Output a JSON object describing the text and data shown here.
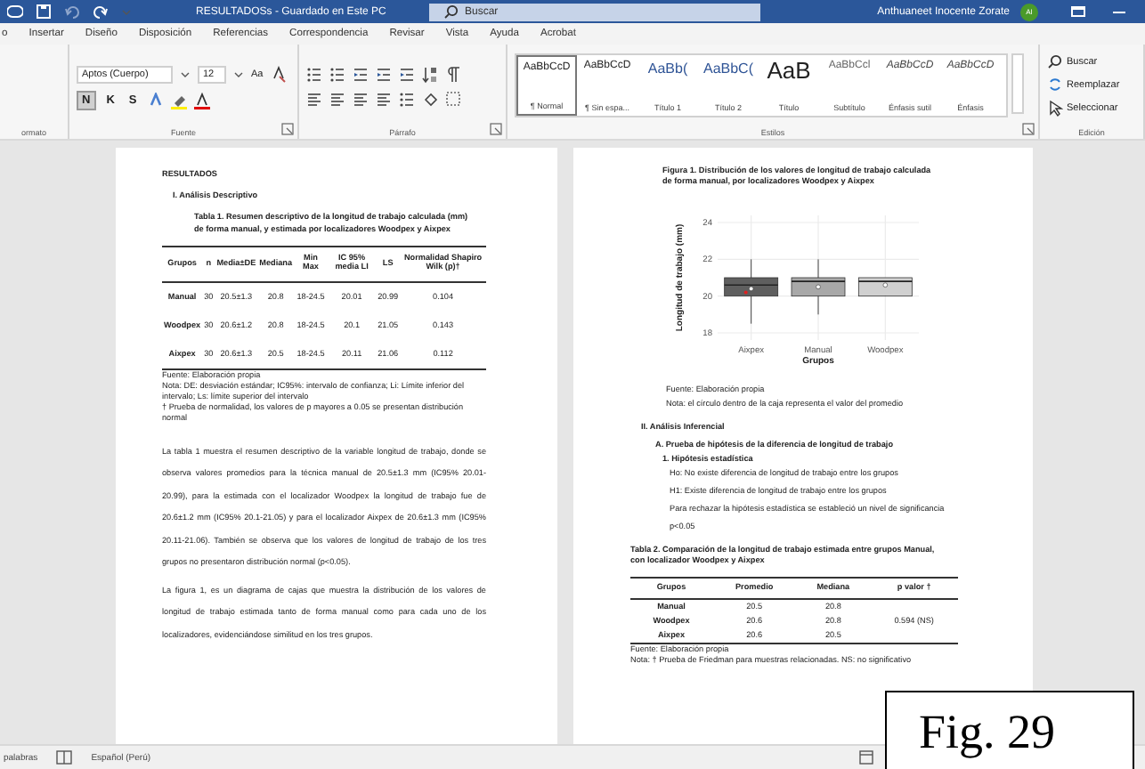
{
  "title_bar": {
    "document_title": "RESULTADOSs - Guardado en Este PC",
    "search_placeholder": "Buscar",
    "user_name": "Anthuaneet Inocente Zorate",
    "avatar_initials": "AI"
  },
  "menu_tabs": [
    {
      "label": "o",
      "selected": false
    },
    {
      "label": "Insertar",
      "selected": false
    },
    {
      "label": "Diseño",
      "selected": false
    },
    {
      "label": "Disposición",
      "selected": false
    },
    {
      "label": "Referencias",
      "selected": false
    },
    {
      "label": "Correspondencia",
      "selected": false
    },
    {
      "label": "Revisar",
      "selected": false
    },
    {
      "label": "Vista",
      "selected": false
    },
    {
      "label": "Ayuda",
      "selected": false
    },
    {
      "label": "Acrobat",
      "selected": false
    }
  ],
  "ribbon": {
    "left_group_label": "ormato",
    "font_name": "Aptos (Cuerpo)",
    "font_size": "12",
    "case_button": "Aa",
    "format_buttons": [
      {
        "label": "N",
        "on": true
      },
      {
        "label": "K",
        "on": false
      },
      {
        "label": "S",
        "on": false
      }
    ],
    "groups": [
      "Fuente",
      "Párrafo",
      "Estilos",
      "Edición"
    ],
    "styles": [
      {
        "preview": "AaBbCcD",
        "label": "¶ Normal",
        "selected": true,
        "kind": "small"
      },
      {
        "preview": "AaBbCcD",
        "label": "¶ Sin espa...",
        "selected": false,
        "kind": "small"
      },
      {
        "preview": "AaBb(",
        "label": "Título 1",
        "selected": false,
        "kind": "heading"
      },
      {
        "preview": "AaBbC(",
        "label": "Título 2",
        "selected": false,
        "kind": "heading"
      },
      {
        "preview": "AaB",
        "label": "Título",
        "selected": false,
        "kind": "title"
      },
      {
        "preview": "AaBbCcl",
        "label": "Subtítulo",
        "selected": false,
        "kind": "subtle"
      },
      {
        "preview": "AaBbCcD",
        "label": "Énfasis sutil",
        "selected": false,
        "kind": "italic"
      },
      {
        "preview": "AaBbCcD",
        "label": "Énfasis",
        "selected": false,
        "kind": "italic"
      }
    ],
    "editing": [
      "Buscar",
      "Reemplazar",
      "Seleccionar"
    ]
  },
  "left_page": {
    "heading": "RESULTADOS",
    "section": "I.   Análisis Descriptivo",
    "table_caption": "Tabla 1. Resumen descriptivo de la longitud de trabajo calculada (mm) de forma manual, y estimada por localizadores Woodpex y Aixpex",
    "table": {
      "columns": [
        "Grupos",
        "n",
        "Media±DE",
        "Mediana",
        "Min  Max",
        "IC 95% media LI",
        "LS",
        "Normalidad Shapiro Wilk (p)†"
      ],
      "rows": [
        [
          "Manual",
          "30",
          "20.5±1.3",
          "20.8",
          "18-24.5",
          "20.01",
          "20.99",
          "0.104"
        ],
        [
          "Woodpex",
          "30",
          "20.6±1.2",
          "20.8",
          "18-24.5",
          "20.1",
          "21.05",
          "0.143"
        ],
        [
          "Aixpex",
          "30",
          "20.6±1.3",
          "20.5",
          "18-24.5",
          "20.11",
          "21.06",
          "0.112"
        ]
      ]
    },
    "notes": [
      "Fuente: Elaboración propia",
      "Nota: DE: desviación estándar; IC95%: intervalo de confianza; Li: Límite inferior del intervalo; Ls: límite superior del intervalo",
      "† Prueba de normalidad, los valores de p mayores a 0.05 se presentan distribución normal"
    ],
    "paragraphs": [
      "La tabla 1 muestra el resumen descriptivo de la variable longitud de trabajo, donde se observa valores promedios para la técnica manual de 20.5±1.3 mm (IC95% 20.01-20.99), para la estimada con el localizador Woodpex la longitud de trabajo fue de 20.6±1.2 mm (IC95% 20.1-21.05) y para el localizador Aixpex de 20.6±1.3 mm (IC95% 20.11-21.06). También se observa que los valores de longitud de trabajo de los tres grupos no presentaron distribución normal (p<0.05).",
      "La figura 1, es un diagrama de cajas que muestra la distribución de los valores de longitud de trabajo estimada tanto de forma manual como para cada uno de los localizadores, evidenciándose similitud en los tres grupos."
    ]
  },
  "right_page": {
    "figure_caption": "Figura 1. Distribución de los valores de longitud de trabajo calculada de forma manual, por localizadores Woodpex y Aixpex",
    "figure": {
      "ylabel": "Longitud de trabajo (mm)",
      "xlabel": "Grupos",
      "categories": [
        "Aixpex",
        "Manual",
        "Woodpex"
      ],
      "yticks": [
        "24",
        "22",
        "20",
        "18"
      ]
    },
    "figure_notes": [
      "Fuente: Elaboración propia",
      "Nota: el círculo dentro de la caja representa el valor del promedio"
    ],
    "section": "II.   Análisis Inferencial",
    "subsection": "A.   Prueba de hipótesis de la diferencia de longitud de trabajo",
    "item": "1.   Hipótesis estadística",
    "lines": [
      "Ho: No existe diferencia de longitud de trabajo entre los grupos",
      "H1: Existe diferencia de longitud de trabajo entre los grupos",
      "Para rechazar la hipótesis estadística se estableció un nivel de significancia",
      "p<0.05"
    ],
    "table_caption": "Tabla 2. Comparación de la longitud de trabajo estimada entre grupos Manual, con localizador Woodpex y Aixpex",
    "table": {
      "columns": [
        "Grupos",
        "Promedio",
        "Mediana",
        "p valor †"
      ],
      "rows": [
        [
          "Manual",
          "20.5",
          "20.8"
        ],
        [
          "Woodpex",
          "20.6",
          "20.8",
          "0.594 (NS)"
        ],
        [
          "Aixpex",
          "20.6",
          "20.5"
        ]
      ]
    },
    "notes": [
      "Fuente: Elaboración propia",
      "Nota: † Prueba de Friedman para muestras relacionadas. NS: no significativo"
    ]
  },
  "status_bar": {
    "word_count": "palabras",
    "language": "Español (Perú)"
  },
  "figure_label": "Fig. 29"
}
